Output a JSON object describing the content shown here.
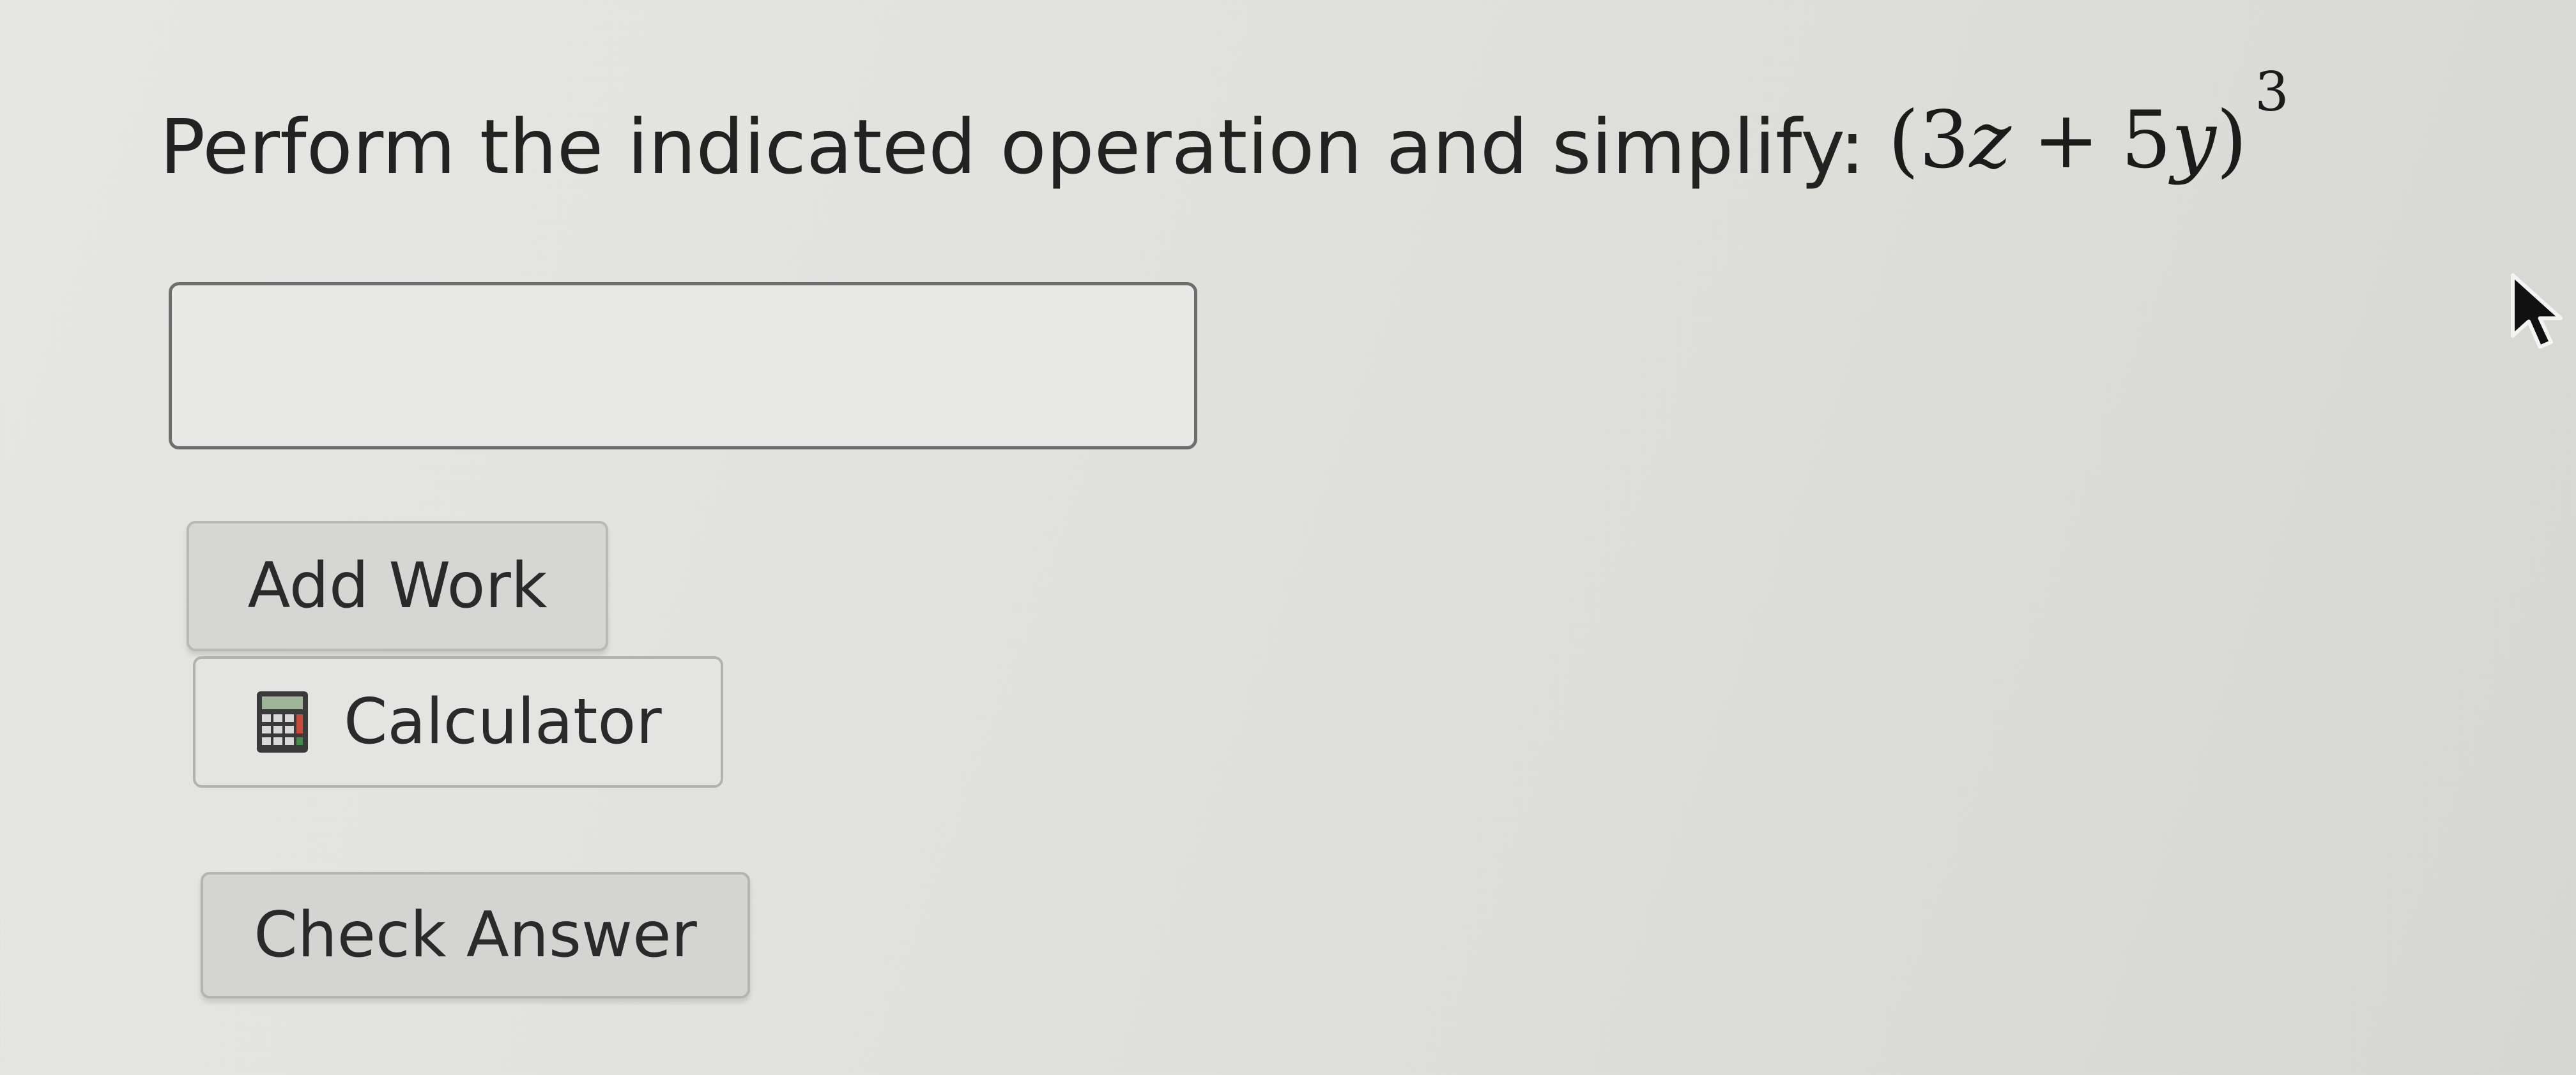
{
  "question": {
    "text": "Perform the indicated operation and simplify:",
    "expression": {
      "open_paren": "(",
      "coef1": "3",
      "var1": "z",
      "operator": "+",
      "coef2": "5",
      "var2": "y",
      "close_paren": ")",
      "exponent": "3"
    }
  },
  "answer_input": {
    "value": "",
    "placeholder": ""
  },
  "buttons": {
    "add_work": "Add Work",
    "calculator": "Calculator",
    "check_answer": "Check Answer"
  },
  "icons": {
    "calculator": "calculator-icon",
    "cursor": "mouse-pointer-icon"
  }
}
